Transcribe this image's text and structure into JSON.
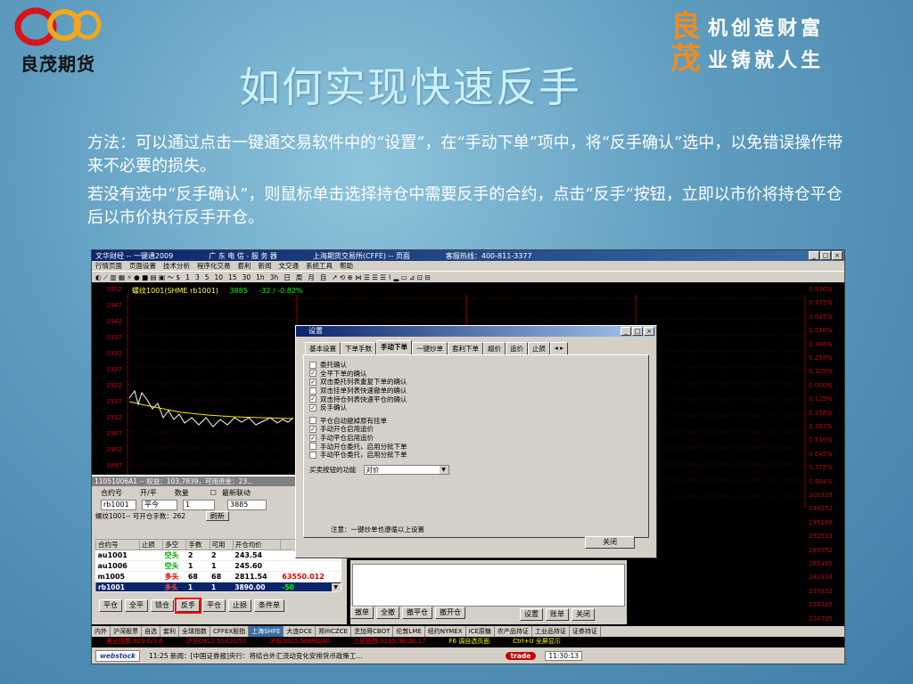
{
  "slide": {
    "logo_text": "良茂期货",
    "slogan": [
      {
        "big": "良",
        "small": "机创造财富"
      },
      {
        "big": "茂",
        "small": "业铸就人生"
      }
    ],
    "title": "如何实现快速反手",
    "paragraphs": [
      "方法：可以通过点击一键通交易软件中的“设置”，在“手动下单”项中，将“反手确认”选中，以免错误操作带来不必要的损失。",
      "若没有选中“反手确认”，则鼠标单击选择持仓中需要反手的合约，点击“反手”按钮，立即以市价将持仓平仓后以市价执行反手开仓。"
    ],
    "accent_color": "#f08c1e",
    "title_color": "#c9f2ff"
  },
  "window": {
    "title": "文华财经 -- 一键通2009",
    "title_extra": [
      "广 东 电 信 - 服 务 器",
      "上海期货交易所(CFFE) -- 页面",
      "客服热线：400-811-3377"
    ],
    "controls": [
      "_",
      "□",
      "×"
    ],
    "menu": [
      "行情页面",
      "页面设置",
      "技术分析",
      "程序化交易",
      "套利",
      "新闻",
      "文交通",
      "系统工具",
      "帮助"
    ],
    "toolbar": [
      "1",
      "3",
      "5",
      "10",
      "15",
      "30",
      "1h",
      "3h",
      "日",
      "周",
      "月",
      "自"
    ],
    "chart_info": {
      "contract": "螺纹1001(SHME rb1001)",
      "price": "3885",
      "change": "-32 / -0.82%"
    },
    "y_left": [
      "3952",
      "3947",
      "3942",
      "3937",
      "3932",
      "3927",
      "3922",
      "3917",
      "3912",
      "3907",
      "3902",
      "3897",
      "3892",
      "3887"
    ],
    "y_right": [
      "0.936%",
      "0.775%",
      "0.645%",
      "0.516%",
      "0.386%",
      "0.258%",
      "0.129%",
      "0.000%",
      "0.129%",
      "0.258%",
      "0.387%",
      "0.516%",
      "0.645%",
      "0.775%",
      "0.904%",
      "303318",
      "299252",
      "295186",
      "292513",
      "289052",
      "285485",
      "281918",
      "279352",
      "276785",
      "274795"
    ]
  },
  "order_panel": {
    "header": "11051006A1 -- 权益：103,7839，可用资金：23...",
    "labels": {
      "contract": "合约号",
      "kaiping": "开/平",
      "qty": "数量",
      "latest": "最新联动"
    },
    "values": {
      "contract": "rb1001",
      "kaiping": "平今",
      "qty": "1",
      "price": "3885"
    },
    "pos_info": "螺纹1001-- 可开仓手数：262",
    "refresh": "刷新",
    "columns": [
      "合约号",
      "止损",
      "多空",
      "手数",
      "可用",
      "开仓均价",
      ""
    ],
    "rows": [
      {
        "code": "au1001",
        "stop": "",
        "side": "空头",
        "hands": "2",
        "avail": "2",
        "avg": "243.54",
        "pl": ""
      },
      {
        "code": "au1006",
        "stop": "",
        "side": "空头",
        "hands": "1",
        "avail": "1",
        "avg": "245.60",
        "pl": ""
      },
      {
        "code": "m1005",
        "stop": "",
        "side": "多头",
        "hands": "68",
        "avail": "68",
        "avg": "2811.54",
        "pl": "63550.012"
      },
      {
        "code": "rb1001",
        "stop": "",
        "side": "多头",
        "hands": "1",
        "avail": "1",
        "avg": "3890.00",
        "pl": "-50"
      }
    ],
    "buttons": [
      "平仓",
      "全平",
      "锁仓",
      "反手",
      "平仓",
      "止损",
      "条件单"
    ],
    "highlight_button": "反手"
  },
  "lower_buttons": {
    "left": [
      "撤单",
      "全撤",
      "撤平仓",
      "撤开仓"
    ],
    "right": [
      "设置",
      "账单",
      "关闭"
    ]
  },
  "dialog": {
    "title": "设置",
    "tabs": [
      "基本设置",
      "下单手数",
      "手动下单",
      "一键炒单",
      "套利下单",
      "超价",
      "追价",
      "止损"
    ],
    "active_tab": "手动下单",
    "options": [
      {
        "label": "委托确认",
        "checked": false
      },
      {
        "label": "全平下单的确认",
        "checked": true
      },
      {
        "label": "双击委托列表重复下单的确认",
        "checked": true
      },
      {
        "label": "双击挂单列表快速撤单的确认",
        "checked": false
      },
      {
        "label": "双击持仓列表快速平仓的确认",
        "checked": true
      },
      {
        "label": "反手确认",
        "checked": true
      },
      {
        "label": "平仓自动撤掉原有挂单",
        "checked": false,
        "gap": true
      },
      {
        "label": "手动开仓启用追价",
        "checked": true
      },
      {
        "label": "手动平仓启用追价",
        "checked": true
      },
      {
        "label": "手动开仓委托，启用分批下单",
        "checked": false
      },
      {
        "label": "手动平仓委托，启用分批下单",
        "checked": false
      }
    ],
    "func_label": "买卖按钮的功能",
    "func_value": "对价",
    "note": "注意：一键炒单也遵循以上设置",
    "close_button": "关闭"
  },
  "tabbar": [
    "内外",
    "沪深股票",
    "自选",
    "套利",
    "全球指数",
    "CFFEX股指",
    "上海SHFE",
    "大连DCE",
    "郑州CZCE",
    "芝加哥CBOT",
    "伦敦LME",
    "纽约NYMEX",
    "ICE原糖",
    "农产品持证",
    "工业品持证",
    "证券持证"
  ],
  "tabbar_active": "上海SHFE",
  "ticker": [
    "美豆指数 929.6/3.6",
    "沪铜0912 50820/50",
    "沪铜1001 50890/40",
    "上证指数 3195.36/20.17",
    "F6 调自选页面",
    "Ctrl+U 全屏显示"
  ],
  "statusbar": {
    "logo": "webstock",
    "news": "11:25 新闻：[中国证券报]央行：将结合外汇流动变化安排货币政策工...",
    "trade": "trade",
    "time": "11:30:13"
  }
}
